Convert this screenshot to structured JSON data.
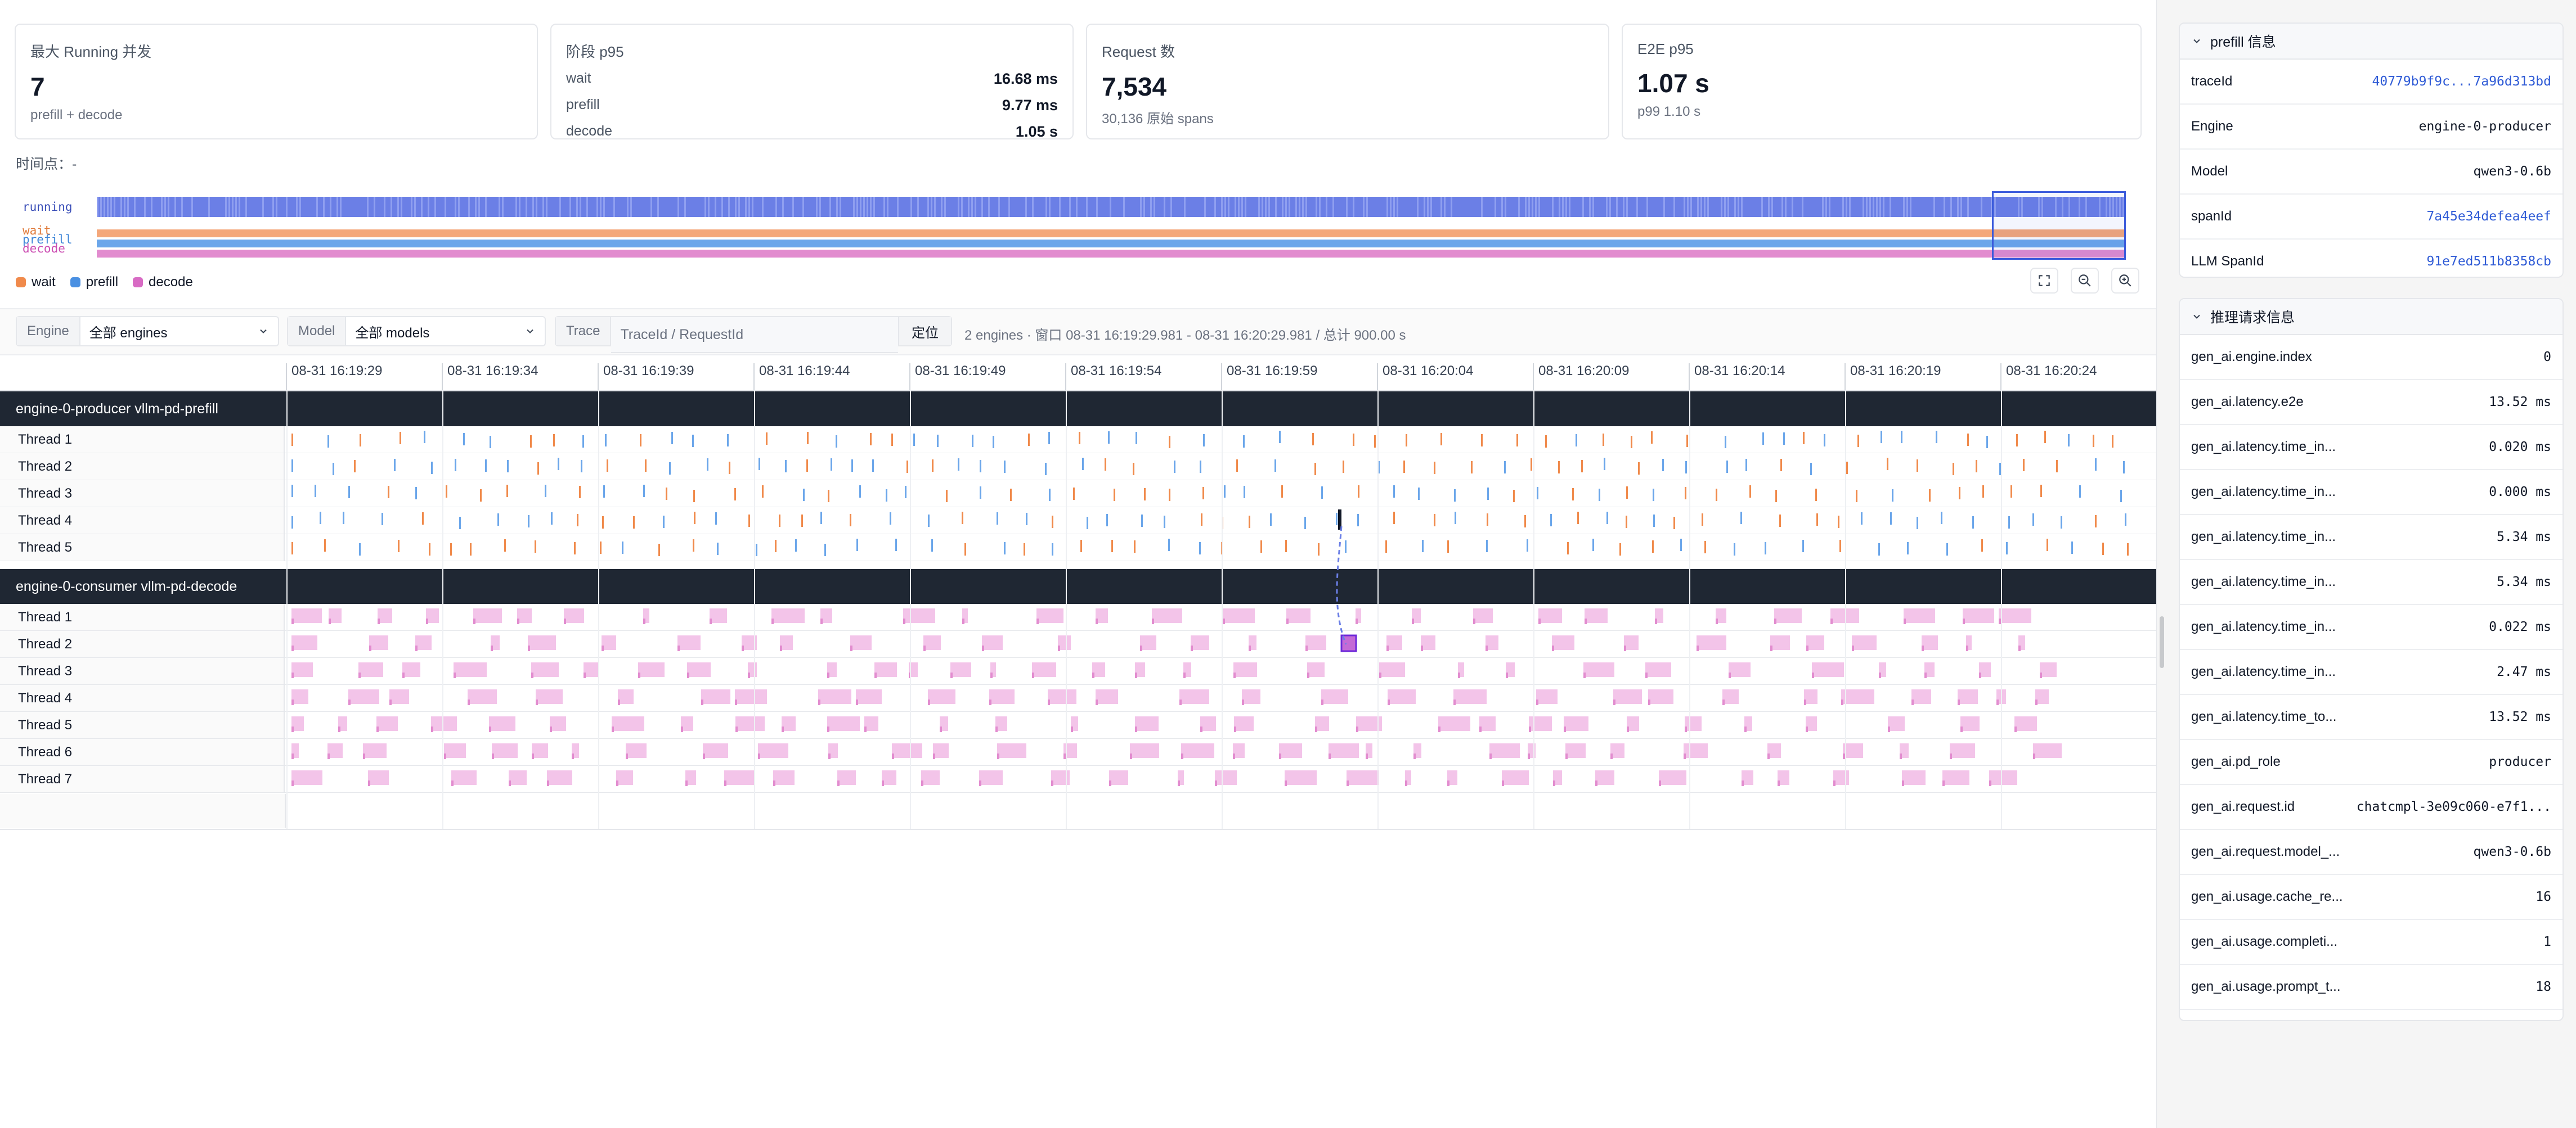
{
  "cards": {
    "max_running": {
      "title": "最大 Running 并发",
      "value": "7",
      "sub": "prefill + decode"
    },
    "phase_p95": {
      "title": "阶段 p95",
      "rows": [
        {
          "label": "wait",
          "value": "16.68 ms"
        },
        {
          "label": "prefill",
          "value": "9.77 ms"
        },
        {
          "label": "decode",
          "value": "1.05 s"
        }
      ]
    },
    "requests": {
      "title": "Request 数",
      "value": "7,534",
      "sub": "30,136 原始 spans"
    },
    "e2e": {
      "title": "E2E p95",
      "value": "1.07 s",
      "sub": "p99 1.10 s"
    }
  },
  "timepoint": "时间点：-",
  "overview": {
    "labels": {
      "running": "running",
      "wait": "wait",
      "prefill": "prefill",
      "decode": "decode"
    },
    "legend": [
      {
        "label": "wait",
        "color": "#f08a4b"
      },
      {
        "label": "prefill",
        "color": "#4a90e2"
      },
      {
        "label": "decode",
        "color": "#d86bc4"
      }
    ],
    "colors": {
      "running": "#6b7fe6",
      "wait": "#f4a77a",
      "prefill": "#6ba6ea",
      "decode": "#e28ccf"
    },
    "buttons": [
      "fullscreen-icon",
      "zoom-out-icon",
      "zoom-in-icon"
    ]
  },
  "filters": {
    "engine_label": "Engine",
    "engine_value": "全部 engines",
    "model_label": "Model",
    "model_value": "全部 models",
    "trace_label": "Trace",
    "trace_placeholder": "TraceId / RequestId",
    "locate_label": "定位",
    "window_info": "2 engines · 窗口 08-31 16:19:29.981 - 08-31 16:20:29.981 / 总计 900.00 s"
  },
  "axis_ticks": [
    "08-31 16:19:29",
    "08-31 16:19:34",
    "08-31 16:19:39",
    "08-31 16:19:44",
    "08-31 16:19:49",
    "08-31 16:19:54",
    "08-31 16:19:59",
    "08-31 16:20:04",
    "08-31 16:20:09",
    "08-31 16:20:14",
    "08-31 16:20:19",
    "08-31 16:20:24"
  ],
  "groups": [
    {
      "name": "engine-0-producer  vllm-pd-prefill",
      "threads": [
        "Thread 1",
        "Thread 2",
        "Thread 3",
        "Thread 4",
        "Thread 5"
      ]
    },
    {
      "name": "engine-0-consumer  vllm-pd-decode",
      "threads": [
        "Thread 1",
        "Thread 2",
        "Thread 3",
        "Thread 4",
        "Thread 5",
        "Thread 6",
        "Thread 7"
      ]
    }
  ],
  "panels": {
    "prefill": {
      "title": "prefill 信息",
      "rows": [
        {
          "k": "traceId",
          "v": "40779b9f9c...7a96d313bd",
          "link": true
        },
        {
          "k": "Engine",
          "v": "engine-0-producer",
          "link": false
        },
        {
          "k": "Model",
          "v": "qwen3-0.6b",
          "link": false
        },
        {
          "k": "spanId",
          "v": "7a45e34defea4eef",
          "link": true
        },
        {
          "k": "LLM SpanId",
          "v": "91e7ed511b8358cb",
          "link": true
        }
      ]
    },
    "request": {
      "title": "推理请求信息",
      "rows": [
        {
          "k": "gen_ai.engine.index",
          "v": "0"
        },
        {
          "k": "gen_ai.latency.e2e",
          "v": "13.52 ms"
        },
        {
          "k": "gen_ai.latency.time_in...",
          "v": "0.020 ms"
        },
        {
          "k": "gen_ai.latency.time_in...",
          "v": "0.000 ms"
        },
        {
          "k": "gen_ai.latency.time_in...",
          "v": "5.34 ms"
        },
        {
          "k": "gen_ai.latency.time_in...",
          "v": "5.34 ms"
        },
        {
          "k": "gen_ai.latency.time_in...",
          "v": "0.022 ms"
        },
        {
          "k": "gen_ai.latency.time_in...",
          "v": "2.47 ms"
        },
        {
          "k": "gen_ai.latency.time_to...",
          "v": "13.52 ms"
        },
        {
          "k": "gen_ai.pd_role",
          "v": "producer"
        },
        {
          "k": "gen_ai.request.id",
          "v": "chatcmpl-3e09c060-e7f1..."
        },
        {
          "k": "gen_ai.request.model_...",
          "v": "qwen3-0.6b"
        },
        {
          "k": "gen_ai.usage.cache_re...",
          "v": "16"
        },
        {
          "k": "gen_ai.usage.completi...",
          "v": "1"
        },
        {
          "k": "gen_ai.usage.prompt_t...",
          "v": "18"
        }
      ]
    }
  }
}
